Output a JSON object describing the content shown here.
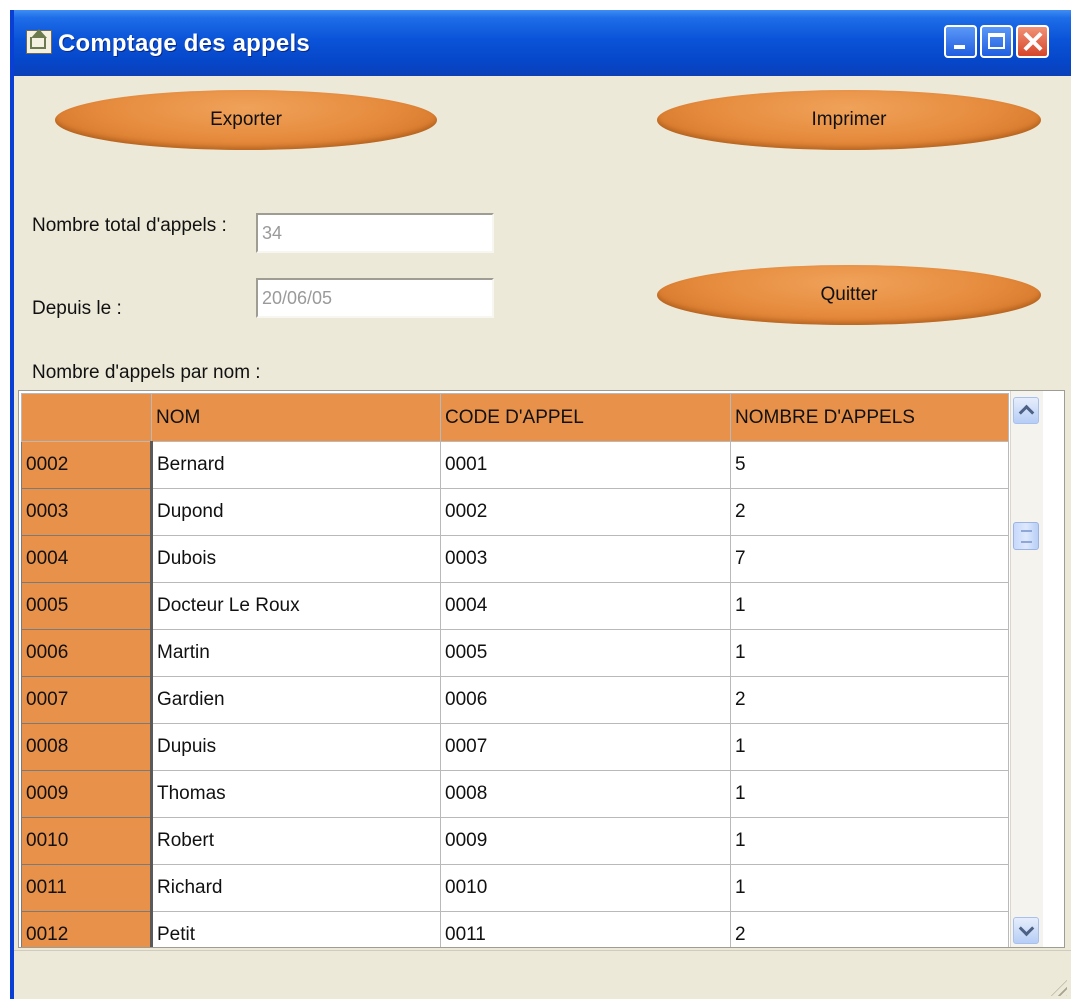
{
  "window": {
    "title": "Comptage des appels",
    "icon": "home-icon"
  },
  "toolbar": {
    "export_label": "Exporter",
    "print_label": "Imprimer",
    "quit_label": "Quitter"
  },
  "form": {
    "total_label": "Nombre total d'appels :",
    "total_value": "34",
    "since_label": "Depuis le :",
    "since_value": "20/06/05"
  },
  "grid": {
    "caption": "Nombre d'appels par nom :",
    "headers": [
      "",
      "NOM",
      "CODE D'APPEL",
      "NOMBRE D'APPELS"
    ],
    "rows": [
      [
        "0002",
        "Bernard",
        "0001",
        "5"
      ],
      [
        "0003",
        "Dupond",
        "0002",
        "2"
      ],
      [
        "0004",
        "Dubois",
        "0003",
        "7"
      ],
      [
        "0005",
        "Docteur Le Roux",
        "0004",
        "1"
      ],
      [
        "0006",
        "Martin",
        "0005",
        "1"
      ],
      [
        "0007",
        "Gardien",
        "0006",
        "2"
      ],
      [
        "0008",
        "Dupuis",
        "0007",
        "1"
      ],
      [
        "0009",
        "Thomas",
        "0008",
        "1"
      ],
      [
        "0010",
        "Robert",
        "0009",
        "1"
      ],
      [
        "0011",
        "Richard",
        "0010",
        "1"
      ],
      [
        "0012",
        "Petit",
        "0011",
        "2"
      ]
    ]
  },
  "colors": {
    "accent_orange": "#E8914A",
    "window_bg": "#ECE9D8",
    "titlebar_blue": "#0A53D8"
  }
}
